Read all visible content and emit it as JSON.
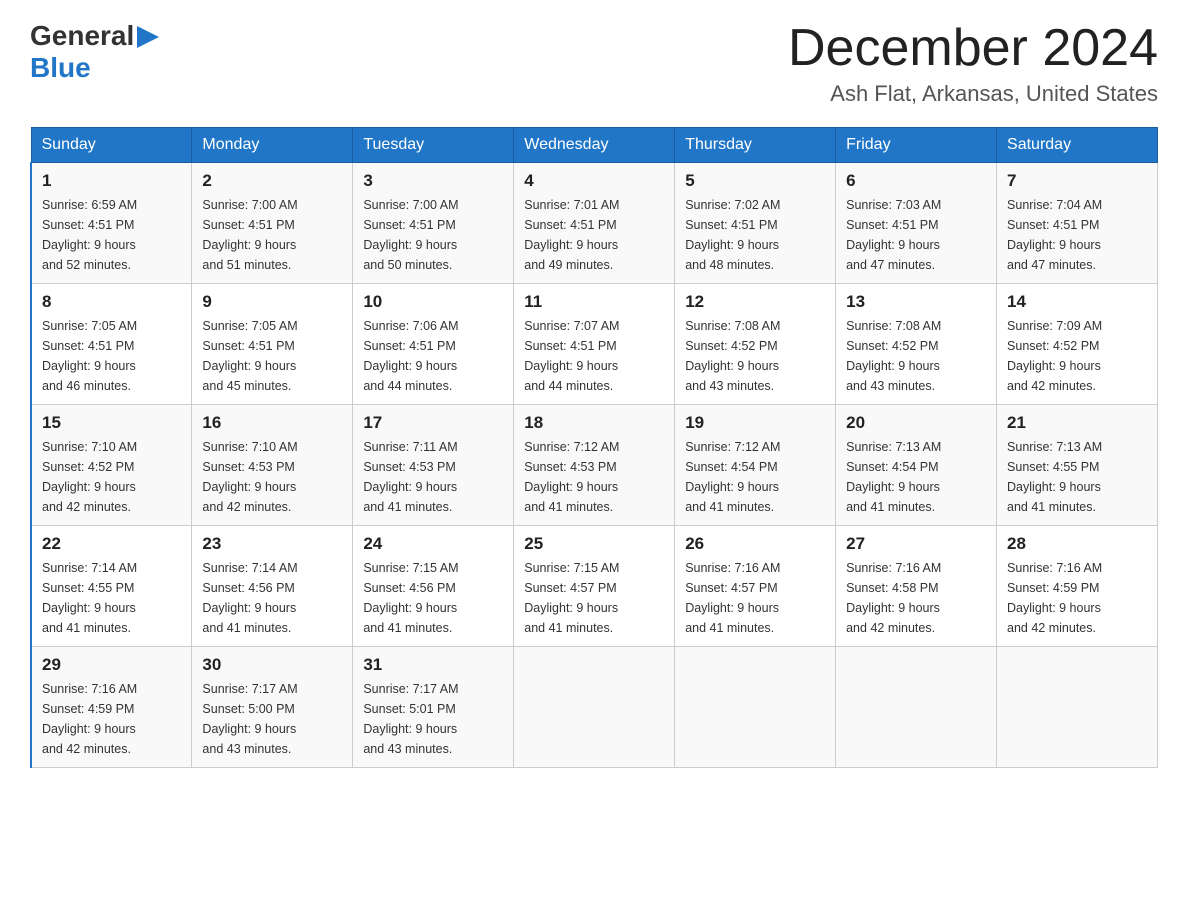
{
  "header": {
    "logo_general": "General",
    "logo_blue": "Blue",
    "month_title": "December 2024",
    "location": "Ash Flat, Arkansas, United States"
  },
  "days_of_week": [
    "Sunday",
    "Monday",
    "Tuesday",
    "Wednesday",
    "Thursday",
    "Friday",
    "Saturday"
  ],
  "weeks": [
    [
      {
        "day": "1",
        "info": "Sunrise: 6:59 AM\nSunset: 4:51 PM\nDaylight: 9 hours\nand 52 minutes."
      },
      {
        "day": "2",
        "info": "Sunrise: 7:00 AM\nSunset: 4:51 PM\nDaylight: 9 hours\nand 51 minutes."
      },
      {
        "day": "3",
        "info": "Sunrise: 7:00 AM\nSunset: 4:51 PM\nDaylight: 9 hours\nand 50 minutes."
      },
      {
        "day": "4",
        "info": "Sunrise: 7:01 AM\nSunset: 4:51 PM\nDaylight: 9 hours\nand 49 minutes."
      },
      {
        "day": "5",
        "info": "Sunrise: 7:02 AM\nSunset: 4:51 PM\nDaylight: 9 hours\nand 48 minutes."
      },
      {
        "day": "6",
        "info": "Sunrise: 7:03 AM\nSunset: 4:51 PM\nDaylight: 9 hours\nand 47 minutes."
      },
      {
        "day": "7",
        "info": "Sunrise: 7:04 AM\nSunset: 4:51 PM\nDaylight: 9 hours\nand 47 minutes."
      }
    ],
    [
      {
        "day": "8",
        "info": "Sunrise: 7:05 AM\nSunset: 4:51 PM\nDaylight: 9 hours\nand 46 minutes."
      },
      {
        "day": "9",
        "info": "Sunrise: 7:05 AM\nSunset: 4:51 PM\nDaylight: 9 hours\nand 45 minutes."
      },
      {
        "day": "10",
        "info": "Sunrise: 7:06 AM\nSunset: 4:51 PM\nDaylight: 9 hours\nand 44 minutes."
      },
      {
        "day": "11",
        "info": "Sunrise: 7:07 AM\nSunset: 4:51 PM\nDaylight: 9 hours\nand 44 minutes."
      },
      {
        "day": "12",
        "info": "Sunrise: 7:08 AM\nSunset: 4:52 PM\nDaylight: 9 hours\nand 43 minutes."
      },
      {
        "day": "13",
        "info": "Sunrise: 7:08 AM\nSunset: 4:52 PM\nDaylight: 9 hours\nand 43 minutes."
      },
      {
        "day": "14",
        "info": "Sunrise: 7:09 AM\nSunset: 4:52 PM\nDaylight: 9 hours\nand 42 minutes."
      }
    ],
    [
      {
        "day": "15",
        "info": "Sunrise: 7:10 AM\nSunset: 4:52 PM\nDaylight: 9 hours\nand 42 minutes."
      },
      {
        "day": "16",
        "info": "Sunrise: 7:10 AM\nSunset: 4:53 PM\nDaylight: 9 hours\nand 42 minutes."
      },
      {
        "day": "17",
        "info": "Sunrise: 7:11 AM\nSunset: 4:53 PM\nDaylight: 9 hours\nand 41 minutes."
      },
      {
        "day": "18",
        "info": "Sunrise: 7:12 AM\nSunset: 4:53 PM\nDaylight: 9 hours\nand 41 minutes."
      },
      {
        "day": "19",
        "info": "Sunrise: 7:12 AM\nSunset: 4:54 PM\nDaylight: 9 hours\nand 41 minutes."
      },
      {
        "day": "20",
        "info": "Sunrise: 7:13 AM\nSunset: 4:54 PM\nDaylight: 9 hours\nand 41 minutes."
      },
      {
        "day": "21",
        "info": "Sunrise: 7:13 AM\nSunset: 4:55 PM\nDaylight: 9 hours\nand 41 minutes."
      }
    ],
    [
      {
        "day": "22",
        "info": "Sunrise: 7:14 AM\nSunset: 4:55 PM\nDaylight: 9 hours\nand 41 minutes."
      },
      {
        "day": "23",
        "info": "Sunrise: 7:14 AM\nSunset: 4:56 PM\nDaylight: 9 hours\nand 41 minutes."
      },
      {
        "day": "24",
        "info": "Sunrise: 7:15 AM\nSunset: 4:56 PM\nDaylight: 9 hours\nand 41 minutes."
      },
      {
        "day": "25",
        "info": "Sunrise: 7:15 AM\nSunset: 4:57 PM\nDaylight: 9 hours\nand 41 minutes."
      },
      {
        "day": "26",
        "info": "Sunrise: 7:16 AM\nSunset: 4:57 PM\nDaylight: 9 hours\nand 41 minutes."
      },
      {
        "day": "27",
        "info": "Sunrise: 7:16 AM\nSunset: 4:58 PM\nDaylight: 9 hours\nand 42 minutes."
      },
      {
        "day": "28",
        "info": "Sunrise: 7:16 AM\nSunset: 4:59 PM\nDaylight: 9 hours\nand 42 minutes."
      }
    ],
    [
      {
        "day": "29",
        "info": "Sunrise: 7:16 AM\nSunset: 4:59 PM\nDaylight: 9 hours\nand 42 minutes."
      },
      {
        "day": "30",
        "info": "Sunrise: 7:17 AM\nSunset: 5:00 PM\nDaylight: 9 hours\nand 43 minutes."
      },
      {
        "day": "31",
        "info": "Sunrise: 7:17 AM\nSunset: 5:01 PM\nDaylight: 9 hours\nand 43 minutes."
      },
      {
        "day": "",
        "info": ""
      },
      {
        "day": "",
        "info": ""
      },
      {
        "day": "",
        "info": ""
      },
      {
        "day": "",
        "info": ""
      }
    ]
  ]
}
